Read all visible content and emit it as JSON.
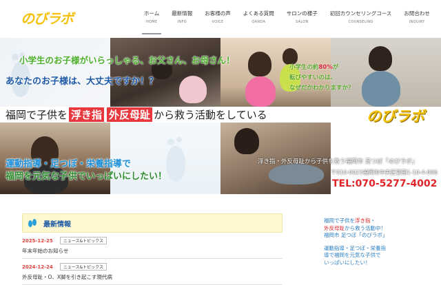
{
  "colors": {
    "accent_red": "#e8383d",
    "brand_yellow": "#f4c20d",
    "nav_active": "#999999",
    "news_bg": "#fdf8d0"
  },
  "header": {
    "logo": "のびラボ",
    "nav": [
      {
        "jp": "ホーム",
        "en": "HOME",
        "active": true
      },
      {
        "jp": "最新情報",
        "en": "INFO"
      },
      {
        "jp": "お客様の声",
        "en": "VOICE"
      },
      {
        "jp": "よくある質問",
        "en": "QANDA"
      },
      {
        "jp": "サロンの様子",
        "en": "SALON"
      },
      {
        "jp": "初回カウンセリングコース",
        "en": "COUNSELING"
      },
      {
        "jp": "お問合わせ",
        "en": "INQUIRY"
      }
    ]
  },
  "hero": {
    "line1": "小学生のお子様がいらっしゃる、お父さん、お母さん！",
    "line2": "あなたのお子様は、大丈夫ですか！？",
    "stat_pre": "小学生の約",
    "stat_pct": "80%",
    "stat_post": "が",
    "stat_line2": "転びやすいのは、",
    "stat_line3": "なぜだかわかりますか？",
    "band_pre": "福岡で子供を",
    "band_hl1": "浮き指",
    "band_hl2": "外反母趾",
    "band_post": "から救う活動をしている",
    "band_logo": "のびラボ",
    "mission1": "運動指導・足つぼ・栄養指導で",
    "mission2": "福岡を元気な子供でいっぱいにしたい！",
    "address1": "浮き指・外反母趾から子供を救う福岡市 足つぼ「のびラボ」",
    "address2": "〒810-0023福岡市中央区警固1-10-4-806",
    "tel": "TEL:070-5277-4002"
  },
  "news": {
    "title": "最新情報",
    "items": [
      {
        "date": "2025-12-25",
        "category": "ニュース&トピックス",
        "title": "年末年始のお知らせ"
      },
      {
        "date": "2024-12-24",
        "category": "ニュース&トピックス",
        "title": "外反母趾・O、X脚を引き起こす現代病"
      }
    ]
  },
  "side": {
    "p1_a": "福岡で子供を",
    "p1_b": "浮き指",
    "p1_c": "・",
    "p1_d": "外反母趾",
    "p1_e": "から救う活動中！",
    "p1_f": "福岡市 足つぼ「のびラボ」",
    "p2_a": "運動指導・足つぼ・栄養指",
    "p2_b": "導で福岡を元気な子供で",
    "p2_c": "いっぱいにしたい！"
  }
}
